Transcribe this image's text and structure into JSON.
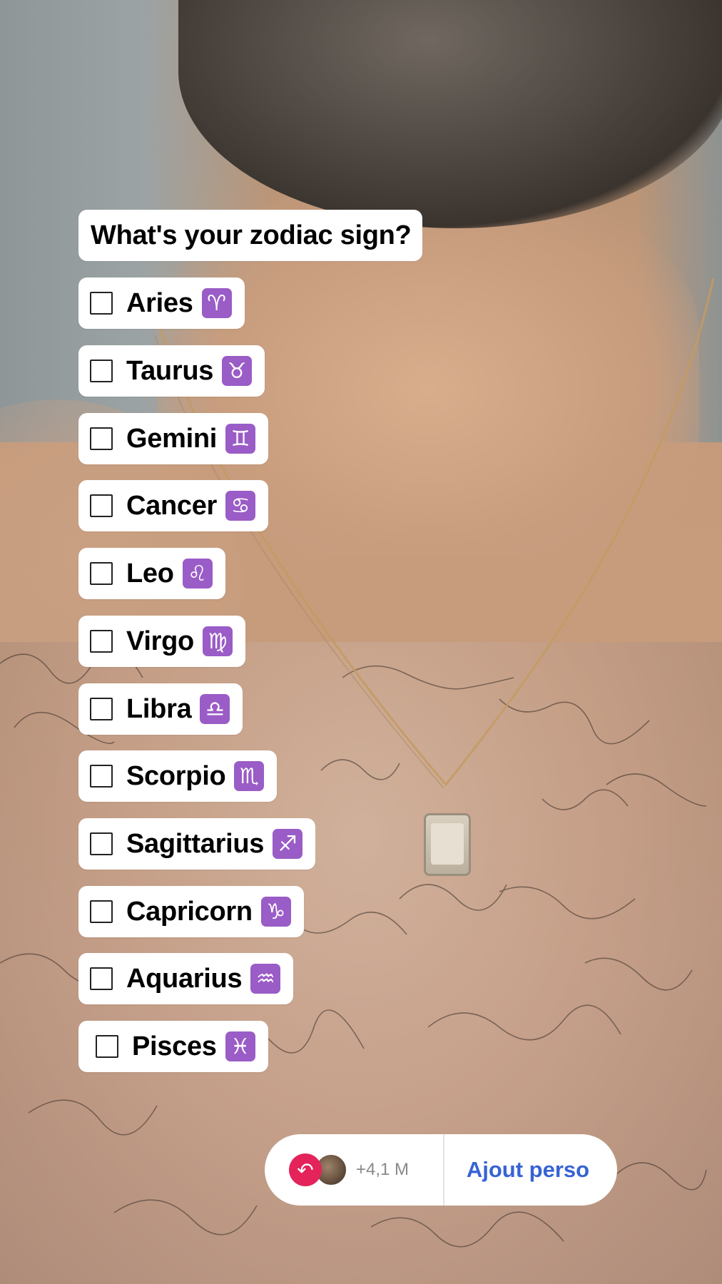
{
  "question": "What's your zodiac sign?",
  "options": [
    {
      "label": "Aries",
      "symbol": "♈"
    },
    {
      "label": "Taurus",
      "symbol": "♉"
    },
    {
      "label": "Gemini",
      "symbol": "♊"
    },
    {
      "label": "Cancer",
      "symbol": "♋"
    },
    {
      "label": "Leo",
      "symbol": "♌"
    },
    {
      "label": "Virgo",
      "symbol": "♍"
    },
    {
      "label": "Libra",
      "symbol": "♎"
    },
    {
      "label": "Scorpio",
      "symbol": "♏"
    },
    {
      "label": "Sagittarius",
      "symbol": "♐"
    },
    {
      "label": "Capricorn",
      "symbol": "♑"
    },
    {
      "label": "Aquarius",
      "symbol": "♒"
    },
    {
      "label": "Pisces",
      "symbol": "♓"
    }
  ],
  "footer": {
    "share_icon": "↶",
    "count": "+4,1 M",
    "action_label": "Ajout perso"
  },
  "colors": {
    "sign_badge": "#9a5cc6",
    "share_icon": "#e3235a",
    "action": "#3763d3"
  }
}
